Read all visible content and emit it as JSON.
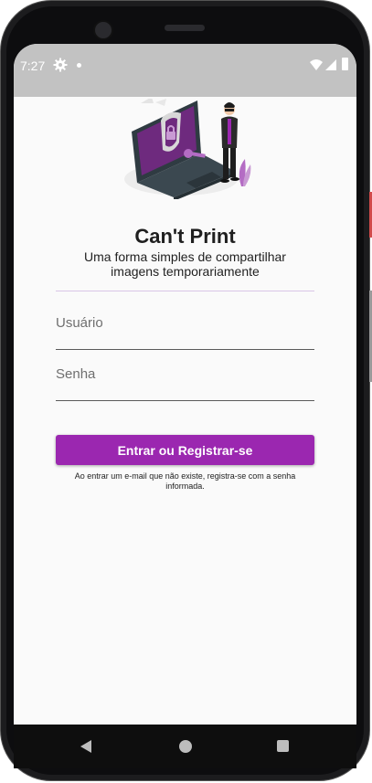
{
  "status_bar": {
    "time": "7:27",
    "icons": [
      "gear-icon",
      "notification-dot-icon",
      "wifi-icon",
      "signal-icon",
      "battery-icon"
    ]
  },
  "app": {
    "title": "Can't Print",
    "subtitle": "Uma forma simples de compartilhar imagens temporariamente",
    "illustration": "security-lock-laptop-illustration"
  },
  "form": {
    "username": {
      "value": "",
      "placeholder": "Usuário"
    },
    "password": {
      "value": "",
      "placeholder": "Senha"
    },
    "submit_label": "Entrar ou Registrar-se",
    "note": "Ao entrar um e-mail que não existe, registra-se com a senha informada."
  },
  "navigation": {
    "buttons": [
      "back-icon",
      "home-icon",
      "recents-icon"
    ]
  },
  "colors": {
    "accent": "#9b27b0",
    "statusbar": "#c2c2c2",
    "background": "#fafafa"
  }
}
